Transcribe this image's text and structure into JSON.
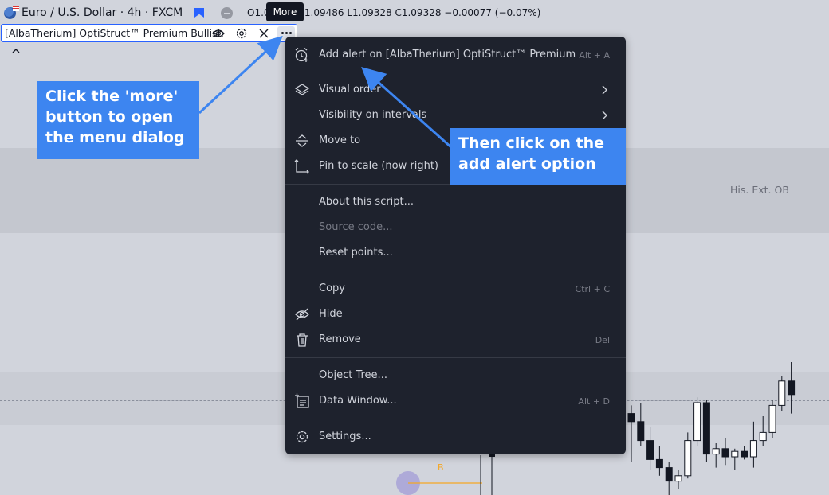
{
  "header": {
    "symbol_title": "Euro / U.S. Dollar · 4h · FXCM",
    "ohlc_text": "O1.09405 H1.09486 L1.09328 C1.09328 −0.00077 (−0.07%)",
    "tooltip": "More"
  },
  "indicator": {
    "label": "[AlbaTherium] OptiStruct™ Premium Bullish"
  },
  "chart": {
    "his_ext_label": "His. Ext. OB",
    "point_label": "B"
  },
  "menu": {
    "items": [
      {
        "label": "Add alert on [AlbaTherium] OptiStruct™ Premium (B",
        "shortcut": "Alt + A"
      },
      {
        "label": "Visual order"
      },
      {
        "label": "Visibility on intervals"
      },
      {
        "label": "Move to"
      },
      {
        "label": "Pin to scale (now right)"
      },
      {
        "label": "About this script..."
      },
      {
        "label": "Source code..."
      },
      {
        "label": "Reset points..."
      },
      {
        "label": "Copy",
        "shortcut": "Ctrl + C"
      },
      {
        "label": "Hide"
      },
      {
        "label": "Remove",
        "shortcut": "Del"
      },
      {
        "label": "Object Tree..."
      },
      {
        "label": "Data Window...",
        "shortcut": "Alt + D"
      },
      {
        "label": "Settings..."
      }
    ]
  },
  "callouts": {
    "left": "Click the 'more' button to open the menu dialog",
    "right": "Then click on the add alert option"
  },
  "colors": {
    "accent": "#2962ff",
    "callout": "#3d85f0",
    "menu_bg": "#1e222d",
    "candle_up": "#ffffff",
    "candle_down": "#131722"
  },
  "chart_data": {
    "type": "candlestick",
    "candles": [
      {
        "o": 1.0921,
        "h": 1.0924,
        "l": 1.0903,
        "c": 1.0918
      },
      {
        "o": 1.0918,
        "h": 1.0925,
        "l": 1.0909,
        "c": 1.0911
      },
      {
        "o": 1.0911,
        "h": 1.0916,
        "l": 1.09,
        "c": 1.0904
      },
      {
        "o": 1.0904,
        "h": 1.0909,
        "l": 1.0898,
        "c": 1.0901
      },
      {
        "o": 1.0901,
        "h": 1.0903,
        "l": 1.089,
        "c": 1.0896
      },
      {
        "o": 1.0896,
        "h": 1.09,
        "l": 1.0893,
        "c": 1.0898
      },
      {
        "o": 1.0898,
        "h": 1.0914,
        "l": 1.0897,
        "c": 1.0911
      },
      {
        "o": 1.0911,
        "h": 1.0927,
        "l": 1.0909,
        "c": 1.0925
      },
      {
        "o": 1.0925,
        "h": 1.0926,
        "l": 1.0903,
        "c": 1.0906
      },
      {
        "o": 1.0906,
        "h": 1.091,
        "l": 1.0901,
        "c": 1.0908
      },
      {
        "o": 1.0908,
        "h": 1.0912,
        "l": 1.0902,
        "c": 1.0905
      },
      {
        "o": 1.0905,
        "h": 1.0908,
        "l": 1.09,
        "c": 1.0907
      },
      {
        "o": 1.0907,
        "h": 1.0909,
        "l": 1.0904,
        "c": 1.0905
      },
      {
        "o": 1.0905,
        "h": 1.0918,
        "l": 1.0901,
        "c": 1.0911
      },
      {
        "o": 1.0911,
        "h": 1.092,
        "l": 1.0909,
        "c": 1.0914
      },
      {
        "o": 1.0914,
        "h": 1.0926,
        "l": 1.0912,
        "c": 1.0924
      },
      {
        "o": 1.0924,
        "h": 1.0935,
        "l": 1.0922,
        "c": 1.0933
      },
      {
        "o": 1.0933,
        "h": 1.094,
        "l": 1.0921,
        "c": 1.0928
      }
    ],
    "scale": {
      "price_top": 1.094,
      "price_bottom": 1.089
    }
  }
}
